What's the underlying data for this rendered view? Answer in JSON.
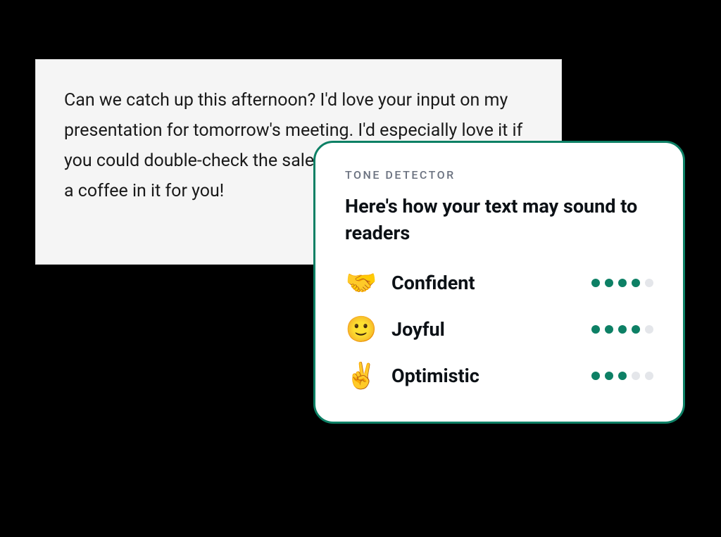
{
  "editor": {
    "text": "Can we catch up this afternoon? I'd love your input on my presentation for tomorrow's meeting. I'd especially love it if you could double-check the sales numbers with me. There's a coffee in it for you!"
  },
  "tone_detector": {
    "label": "TONE DETECTOR",
    "headline": "Here's how your text may sound to readers",
    "tones": [
      {
        "emoji": "🤝",
        "name": "Confident",
        "score": 4,
        "max": 5
      },
      {
        "emoji": "🙂",
        "name": "Joyful",
        "score": 4,
        "max": 5
      },
      {
        "emoji": "✌️",
        "name": "Optimistic",
        "score": 3,
        "max": 5
      }
    ]
  },
  "colors": {
    "accent": "#0d8065",
    "card_bg": "#ffffff",
    "editor_bg": "#f5f5f5",
    "dot_empty": "#e4e6ea"
  }
}
